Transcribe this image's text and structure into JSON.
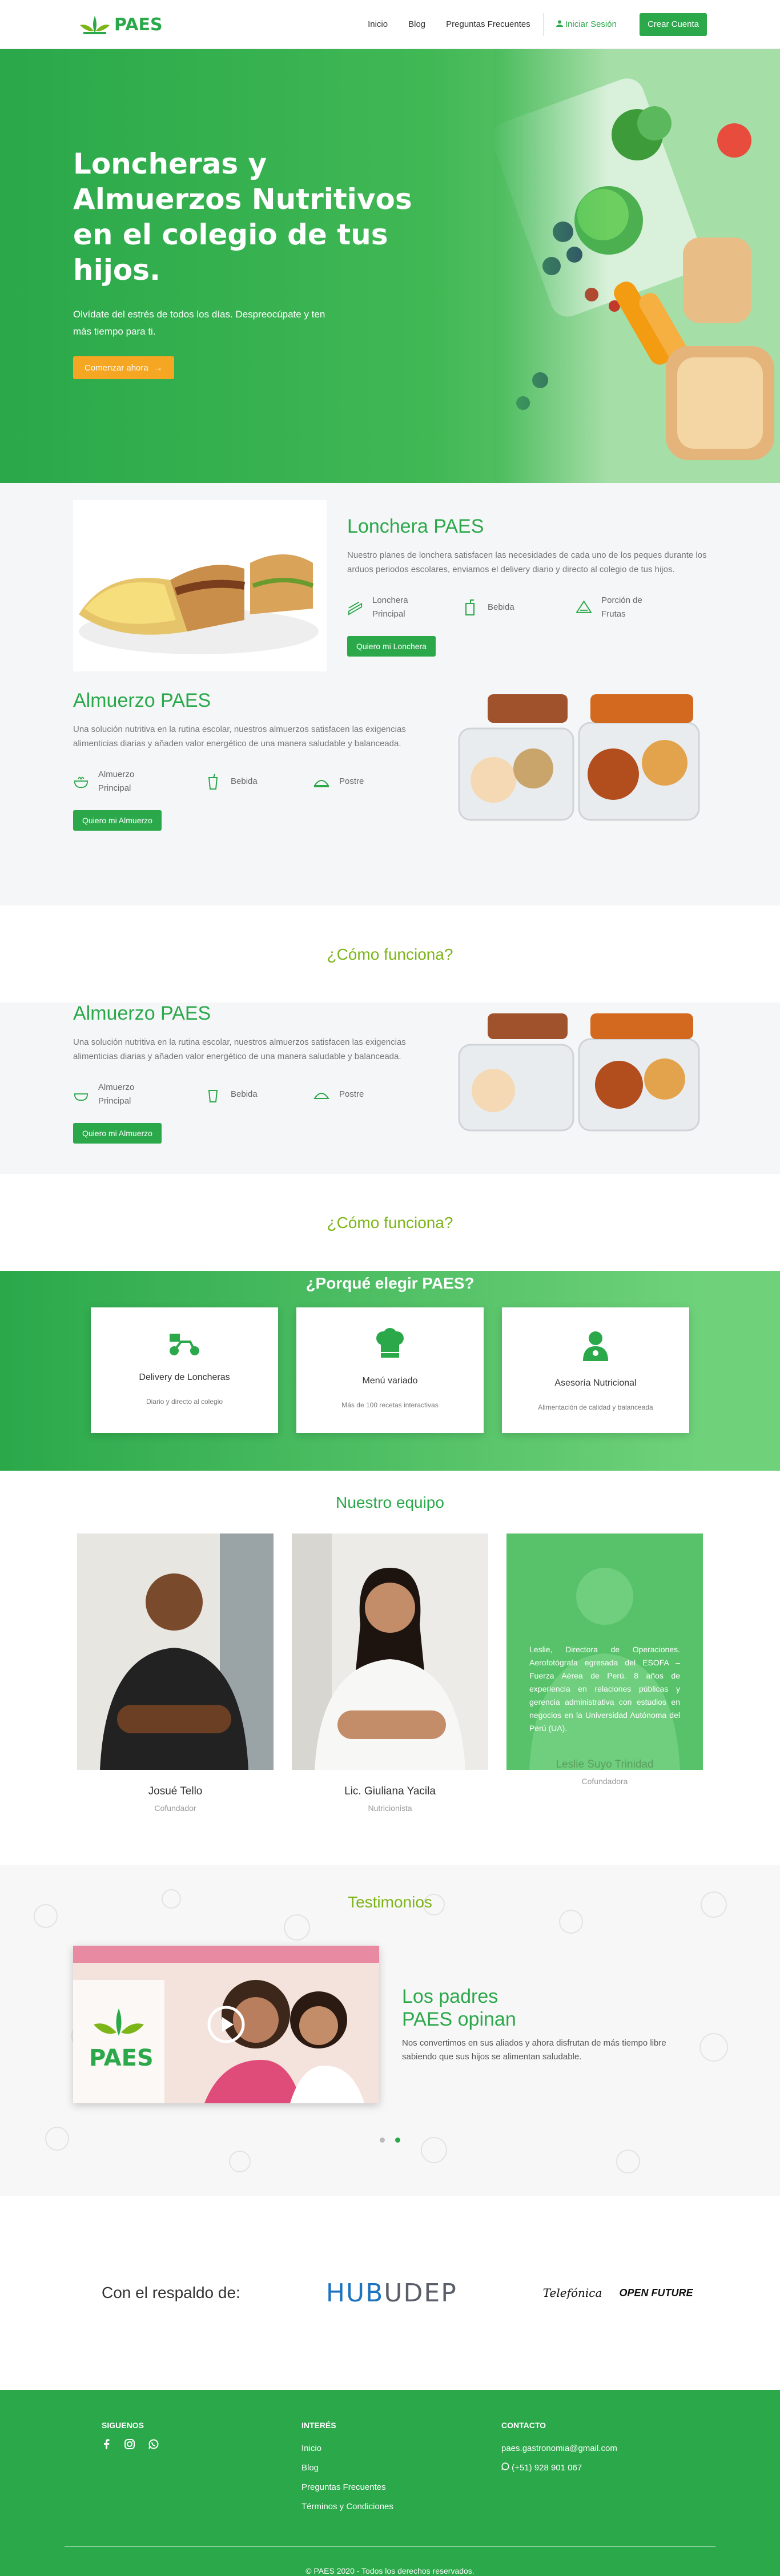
{
  "header": {
    "brand": "PAES",
    "nav": [
      "Inicio",
      "Blog",
      "Preguntas Frecuentes"
    ],
    "login": "Iniciar Sesión",
    "signup": "Crear Cuenta"
  },
  "hero": {
    "title": "Loncheras y Almuerzos Nutritivos en el colegio de tus hijos.",
    "subtitle": "Olvídate del estrés de todos los días. Despreocúpate y ten más tiempo para ti.",
    "cta": "Comenzar ahora"
  },
  "lonchera": {
    "title": "Lonchera PAES",
    "desc": "Nuestro planes de lonchera satisfacen las necesidades de cada uno de los peques durante los arduos periodos escolares, enviamos el delivery diario y directo al colegio de tus hijos.",
    "features": [
      "Lonchera Principal",
      "Bebida",
      "Porción de Frutas"
    ],
    "cta": "Quiero mi Lonchera"
  },
  "almuerzo": {
    "title": "Almuerzo PAES",
    "desc": "Una solución nutritiva en la rutina escolar, nuestros almuerzos satisfacen las exigencias alimenticias diarias y añaden valor energético de una manera saludable y balanceada.",
    "features": [
      "Almuerzo Principal",
      "Bebida",
      "Postre"
    ],
    "cta": "Quiero mi Almuerzo"
  },
  "how": {
    "title": "¿Cómo funciona?"
  },
  "why": {
    "title": "¿Porqué elegir PAES?",
    "cards": [
      {
        "title": "Delivery de Loncheras",
        "text": "Diario y directo al colegio",
        "icon": "scooter-icon"
      },
      {
        "title": "Menú variado",
        "text": "Más de 100 recetas interactivas",
        "icon": "chef-hat-icon"
      },
      {
        "title": "Asesoría Nutricional",
        "text": "Alimentación de calidad y balanceada",
        "icon": "nutritionist-icon"
      }
    ]
  },
  "team": {
    "title": "Nuestro equipo",
    "members": [
      {
        "name": "Josué Tello",
        "role": "Cofundador"
      },
      {
        "name": "Lic. Giuliana Yacila",
        "role": "Nutricionista"
      },
      {
        "name": "Leslie Suyo Trinidad",
        "role": "Cofundadora",
        "bio": "Leslie, Directora de Operaciones. Aerofotógrafa egresada del ESOFA – Fuerza Aérea de Perú. 8 años de experiencia en relaciones públicas y gerencia administrativa con estudios en negocios en la Universidad Autónoma del Perú (UA)."
      }
    ]
  },
  "testimonials": {
    "title": "Testimonios",
    "heading": "Los padres PAES opinan",
    "text": "Nos convertimos en sus aliados y ahora disfrutan de más tiempo libre sabiendo que sus hijos se alimentan saludable.",
    "video_logo": "PAES"
  },
  "sponsors": {
    "label": "Con el respaldo de:",
    "hub_a": "HUB",
    "hub_b": "UDEP",
    "tel_a": "Telefónica",
    "tel_b": "OPEN FUTURE"
  },
  "footer": {
    "follow": "SIGUENOS",
    "interest": "INTERÉS",
    "links": [
      "Inicio",
      "Blog",
      "Preguntas Frecuentes",
      "Términos y Condiciones"
    ],
    "contact": "CONTACTO",
    "email": "paes.gastronomia@gmail.com",
    "phone": "(+51) 928 901 067",
    "copyright": "© PAES 2020 - Todos los derechos reservados."
  },
  "colors": {
    "brand": "#2aa84a",
    "accent": "#f5a623",
    "title_lime": "#7cb518"
  }
}
